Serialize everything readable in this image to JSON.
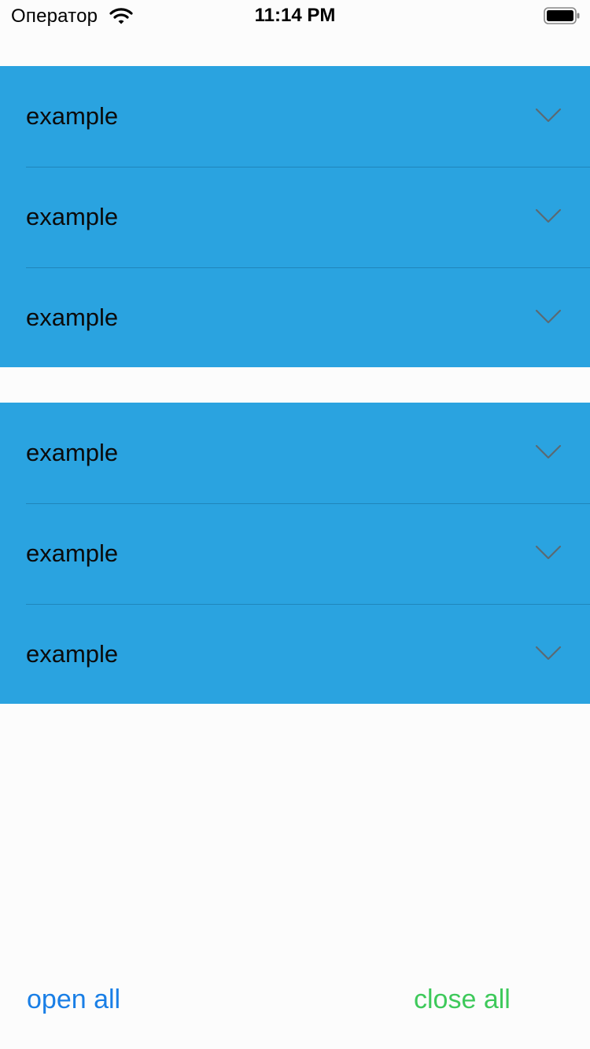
{
  "status_bar": {
    "carrier": "Оператор",
    "time": "11:14 PM",
    "wifi_icon": "wifi-icon",
    "battery_icon": "battery-icon"
  },
  "sections": [
    {
      "rows": [
        {
          "label": "example",
          "icon": "chevron-down-icon"
        },
        {
          "label": "example",
          "icon": "chevron-down-icon"
        },
        {
          "label": "example",
          "icon": "chevron-down-icon"
        }
      ]
    },
    {
      "rows": [
        {
          "label": "example",
          "icon": "chevron-down-icon"
        },
        {
          "label": "example",
          "icon": "chevron-down-icon"
        },
        {
          "label": "example",
          "icon": "chevron-down-icon"
        }
      ]
    }
  ],
  "footer": {
    "open_all": "open all",
    "close_all": "close all"
  },
  "colors": {
    "section_background": "#2aa3e0",
    "open_all": "#1a7fe6",
    "close_all": "#3ec95b",
    "page_background": "#fcfcfc"
  }
}
